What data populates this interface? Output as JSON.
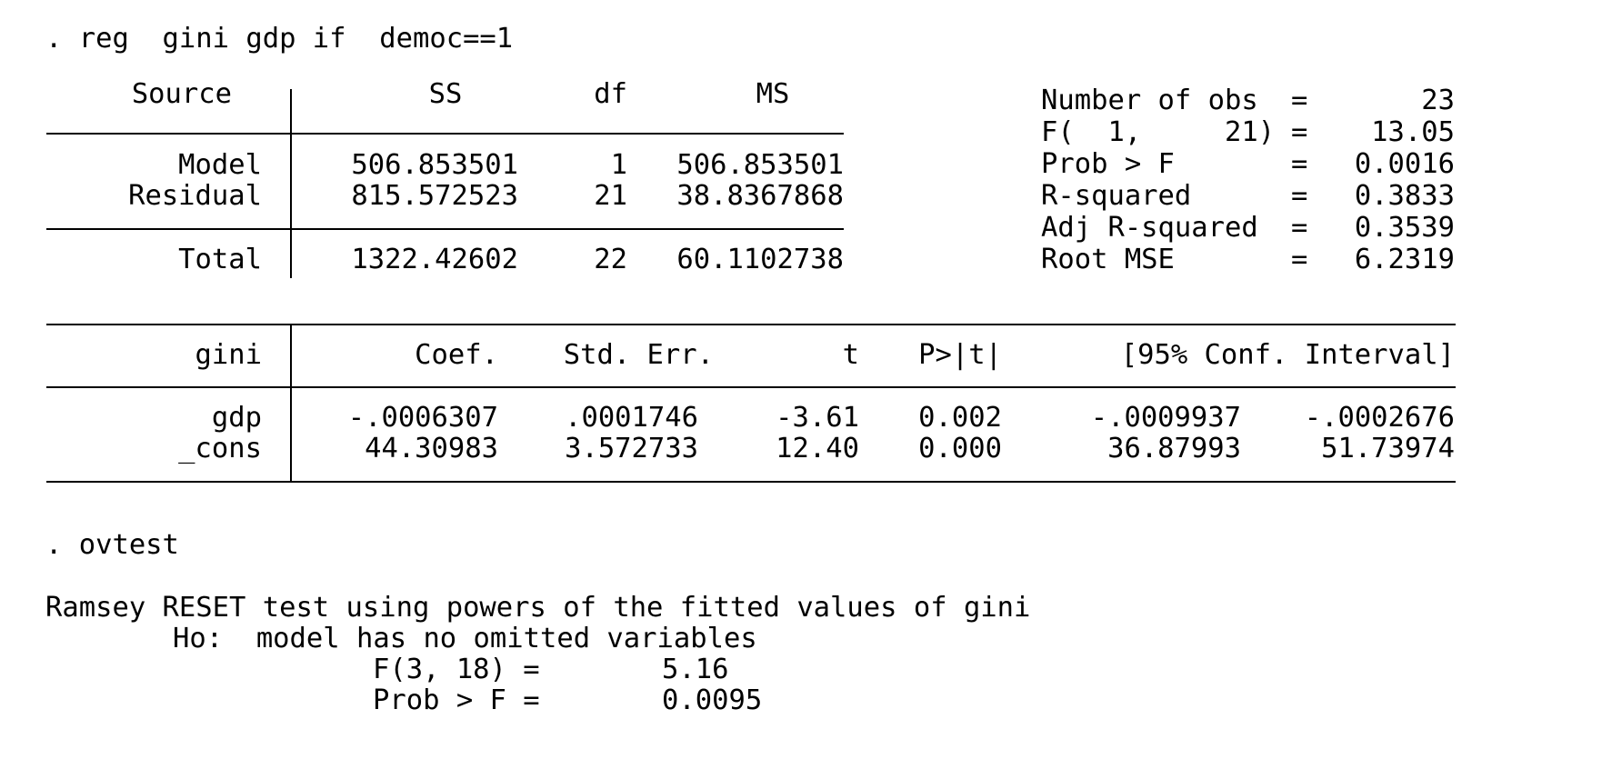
{
  "window": {
    "background": "#ffffff",
    "text_color": "#000000"
  },
  "commands": {
    "reg": ". reg  gini gdp if  democ==1",
    "ovtest": ". ovtest"
  },
  "anova": {
    "headers": {
      "source": "Source",
      "ss": "SS",
      "df": "df",
      "ms": "MS"
    },
    "rows": [
      {
        "source": "Model",
        "ss": "506.853501",
        "df": "1",
        "ms": "506.853501"
      },
      {
        "source": "Residual",
        "ss": "815.572523",
        "df": "21",
        "ms": "38.8367868"
      }
    ],
    "total": {
      "source": "Total",
      "ss": "1322.42602",
      "df": "22",
      "ms": "60.1102738"
    }
  },
  "fit_stats": [
    {
      "label": "Number of obs",
      "eq": "=",
      "value": "23"
    },
    {
      "label": "F(  1,     21)",
      "eq": "=",
      "value": "13.05"
    },
    {
      "label": "Prob > F",
      "eq": "=",
      "value": "0.0016"
    },
    {
      "label": "R-squared",
      "eq": "=",
      "value": "0.3833"
    },
    {
      "label": "Adj R-squared",
      "eq": "=",
      "value": "0.3539"
    },
    {
      "label": "Root MSE",
      "eq": "=",
      "value": "6.2319"
    }
  ],
  "coef_table": {
    "headers": {
      "var": "gini",
      "coef": "Coef.",
      "se": "Std. Err.",
      "t": "t",
      "p": "P>|t|",
      "ci": "[95% Conf. Interval]"
    },
    "rows": [
      {
        "var": "gdp",
        "coef": "-.0006307",
        "se": ".0001746",
        "t": "-3.61",
        "p": "0.002",
        "ci_low": "-.0009937",
        "ci_high": "-.0002676"
      },
      {
        "var": "_cons",
        "coef": "44.30983",
        "se": "3.572733",
        "t": "12.40",
        "p": "0.000",
        "ci_low": "36.87993",
        "ci_high": "51.73974"
      }
    ]
  },
  "ovtest": {
    "title": "Ramsey RESET test using powers of the fitted values of gini",
    "hypothesis": "Ho:  model has no omitted variables",
    "stat_label": "F(3, 18) =",
    "stat_value": "5.16",
    "prob_label": "Prob > F =",
    "prob_value": "0.0095"
  }
}
